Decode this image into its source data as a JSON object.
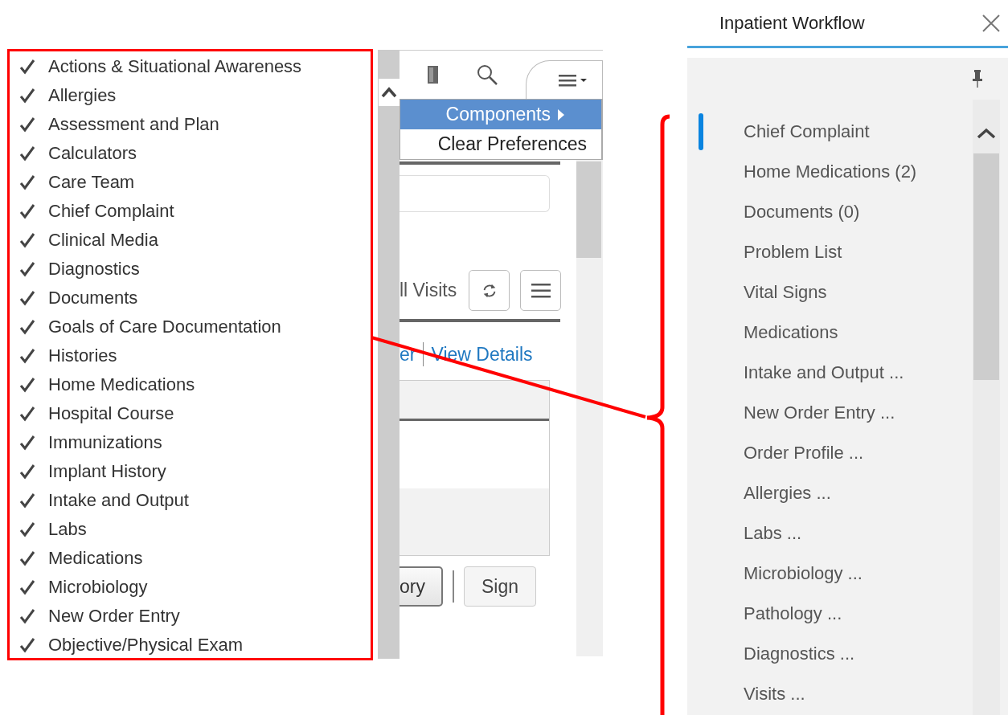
{
  "components_list": {
    "items": [
      {
        "label": "Actions & Situational Awareness",
        "checked": true
      },
      {
        "label": "Allergies",
        "checked": true
      },
      {
        "label": "Assessment and Plan",
        "checked": true
      },
      {
        "label": "Calculators",
        "checked": true
      },
      {
        "label": "Care Team",
        "checked": true
      },
      {
        "label": "Chief Complaint",
        "checked": true
      },
      {
        "label": "Clinical Media",
        "checked": true
      },
      {
        "label": "Diagnostics",
        "checked": true
      },
      {
        "label": "Documents",
        "checked": true
      },
      {
        "label": "Goals of Care Documentation",
        "checked": true
      },
      {
        "label": "Histories",
        "checked": true
      },
      {
        "label": "Home Medications",
        "checked": true
      },
      {
        "label": "Hospital Course",
        "checked": true
      },
      {
        "label": "Immunizations",
        "checked": true
      },
      {
        "label": "Implant History",
        "checked": true
      },
      {
        "label": "Intake and Output",
        "checked": true
      },
      {
        "label": "Labs",
        "checked": true
      },
      {
        "label": "Medications",
        "checked": true
      },
      {
        "label": "Microbiology",
        "checked": true
      },
      {
        "label": "New Order Entry",
        "checked": true
      },
      {
        "label": "Objective/Physical Exam",
        "checked": true
      }
    ]
  },
  "page_panel": {
    "options_menu": [
      {
        "label": "Components",
        "selected": true,
        "submenu": true
      },
      {
        "label": "Clear Preferences",
        "selected": false,
        "submenu": false
      }
    ],
    "visits_label": "ll Visits",
    "links": [
      "er",
      "View Details"
    ],
    "buttons": [
      {
        "label": "ory",
        "kind": "default"
      },
      {
        "label": "Sign",
        "kind": "plain"
      }
    ]
  },
  "workflow_panel": {
    "title": "Inpatient Workflow",
    "items": [
      {
        "label": "Chief Complaint",
        "selected": true
      },
      {
        "label": "Home Medications (2)",
        "selected": false
      },
      {
        "label": "Documents (0)",
        "selected": false
      },
      {
        "label": "Problem List",
        "selected": false
      },
      {
        "label": "Vital Signs",
        "selected": false
      },
      {
        "label": "Medications",
        "selected": false
      },
      {
        "label": "Intake and Output ...",
        "selected": false
      },
      {
        "label": "New Order Entry ...",
        "selected": false
      },
      {
        "label": "Order Profile ...",
        "selected": false
      },
      {
        "label": "Allergies ...",
        "selected": false
      },
      {
        "label": "Labs ...",
        "selected": false
      },
      {
        "label": "Microbiology ...",
        "selected": false
      },
      {
        "label": "Pathology ...",
        "selected": false
      },
      {
        "label": "Diagnostics ...",
        "selected": false
      },
      {
        "label": "Visits ...",
        "selected": false
      }
    ]
  }
}
